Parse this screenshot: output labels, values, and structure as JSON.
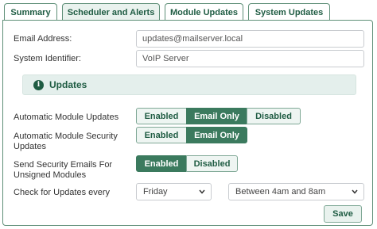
{
  "tabs": [
    "Summary",
    "Scheduler and Alerts",
    "Module Updates",
    "System Updates"
  ],
  "active_tab": "Scheduler and Alerts",
  "form": {
    "email_label": "Email Address:",
    "email_value": "updates@mailserver.local",
    "system_id_label": "System Identifier:",
    "system_id_value": "VoIP Server"
  },
  "updates_section": {
    "icon": "info-circle-icon",
    "title": "Updates"
  },
  "settings": {
    "auto_module_updates": {
      "label": "Automatic Module Updates",
      "options": [
        "Enabled",
        "Email Only",
        "Disabled"
      ],
      "selected": "Email Only"
    },
    "auto_security_updates": {
      "label_line1": "Automatic Module Security",
      "label_line2": "Updates",
      "options": [
        "Enabled",
        "Email Only"
      ],
      "selected": "Email Only"
    },
    "security_emails_unsigned": {
      "label_line1": "Send Security Emails For",
      "label_line2": "Unsigned Modules",
      "options": [
        "Enabled",
        "Disabled"
      ],
      "selected": "Enabled"
    },
    "check_schedule": {
      "label": "Check for Updates every",
      "day": "Friday",
      "time": "Between 4am and 8am"
    }
  },
  "save_label": "Save",
  "colors": {
    "accent": "#3b7a5e",
    "accent_dark": "#1f5c43",
    "section_bg": "#e4efec"
  }
}
